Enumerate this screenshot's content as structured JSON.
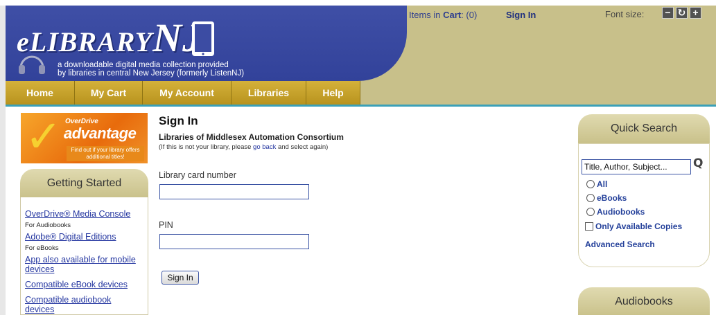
{
  "header": {
    "logo_prefix": "eLIBRARY",
    "logo_suffix": "NJ",
    "tagline_line1": "a downloadable digital media collection provided",
    "tagline_line2": "by libraries in central New Jersey (formerly ListenNJ)",
    "cart_label": "Items in",
    "cart_word": "Cart",
    "cart_count": ": (0)",
    "sign_in": "Sign In",
    "font_size_label": "Font size:",
    "font_decrease": "−",
    "font_reset": "↻",
    "font_increase": "+"
  },
  "nav": {
    "items": [
      {
        "label": "Home"
      },
      {
        "label": "My Cart"
      },
      {
        "label": "My Account"
      },
      {
        "label": "Libraries"
      },
      {
        "label": "Help"
      }
    ]
  },
  "promo": {
    "small": "OverDrive",
    "title": "advantage",
    "tag": "Find out if your library offers additional titles!"
  },
  "getting_started": {
    "title": "Getting Started",
    "items": [
      {
        "link": "OverDrive® Media Console",
        "note": "For Audiobooks"
      },
      {
        "link": "Adobe® Digital Editions",
        "note": "For eBooks"
      },
      {
        "link": "App also available for mobile devices"
      },
      {
        "link": "Compatible eBook devices"
      },
      {
        "link": "Compatible audiobook devices"
      }
    ]
  },
  "main": {
    "title": "Sign In",
    "subtitle": "Libraries of Middlesex Automation Consortium",
    "note_before": "(If this is not your library, please ",
    "note_link": "go back",
    "note_after": " and select again)",
    "card_label": "Library card number",
    "card_value": "",
    "pin_label": "PIN",
    "pin_value": "",
    "signin_button": "Sign In"
  },
  "quick_search": {
    "title": "Quick Search",
    "placeholder": "Title, Author, Subject...",
    "options": [
      "All",
      "eBooks",
      "Audiobooks"
    ],
    "available_only": "Only Available Copies",
    "advanced": "Advanced Search"
  },
  "audiobooks": {
    "title": "Audiobooks"
  },
  "colors": {
    "banner_blue": "#3f4fa6",
    "nav_gold": "#c9a42c",
    "header_khaki": "#c8c08a",
    "link_blue": "#2436a0"
  }
}
